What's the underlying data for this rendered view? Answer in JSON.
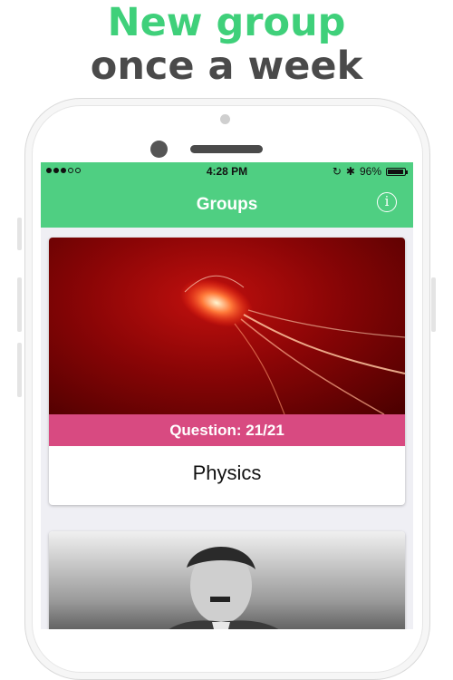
{
  "headline": {
    "line1": "New group",
    "line2": "once a week"
  },
  "status_bar": {
    "time": "4:28 PM",
    "battery": "96%",
    "battery_level": 0.96
  },
  "nav": {
    "title": "Groups",
    "info_icon": "info-icon"
  },
  "groups": [
    {
      "progress": "Question: 21/21",
      "title": "Physics",
      "image": "glowing-comet-photo"
    },
    {
      "image": "black-and-white-portrait-photo"
    }
  ],
  "colors": {
    "accent_green": "#4fcf82",
    "headline_green": "#3fd07a",
    "progress_pink": "#d84a81"
  }
}
